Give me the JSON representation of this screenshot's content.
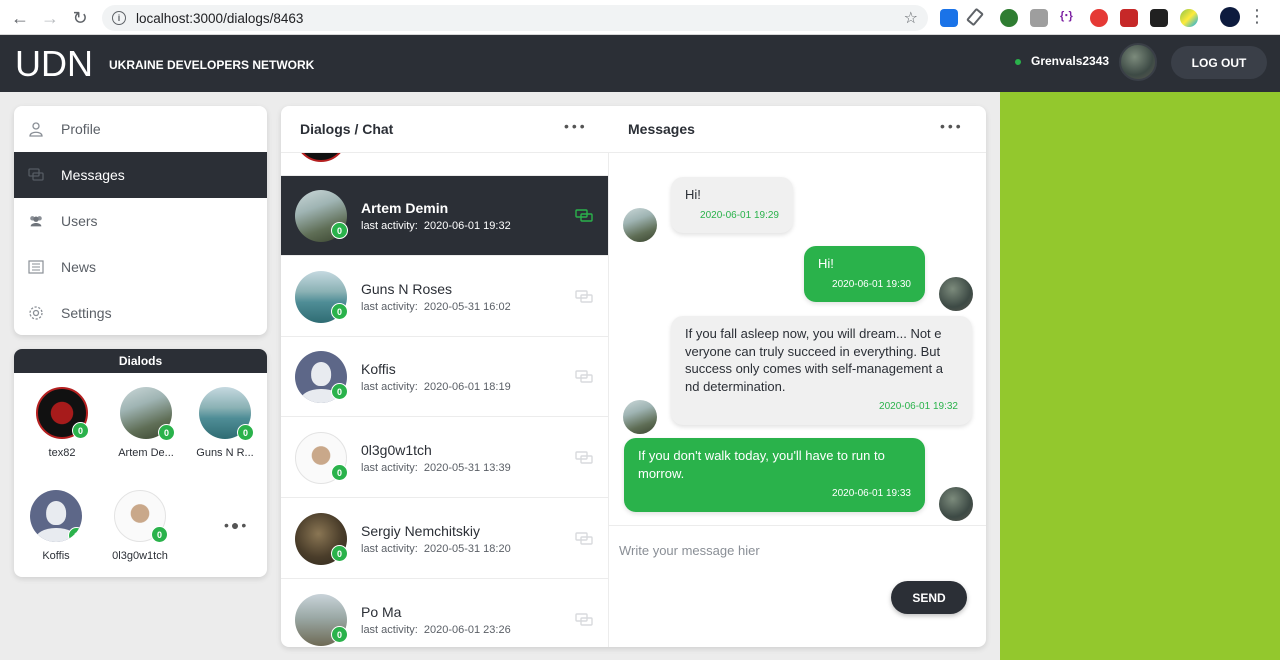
{
  "browser": {
    "url": "localhost:3000/dialogs/8463"
  },
  "header": {
    "logo": "UDN",
    "subtitle": "UKRAINE DEVELOPERS NETWORK",
    "username": "Grenvals2343",
    "logout_label": "LOG OUT"
  },
  "sidebar": {
    "items": [
      {
        "label": "Profile",
        "icon": "user-icon"
      },
      {
        "label": "Messages",
        "icon": "messages-icon",
        "active": true
      },
      {
        "label": "Users",
        "icon": "users-icon"
      },
      {
        "label": "News",
        "icon": "news-icon"
      },
      {
        "label": "Settings",
        "icon": "gear-icon"
      }
    ]
  },
  "dialogs_box": {
    "title": "Dialods",
    "users": [
      {
        "name": "tex82",
        "badge": "0"
      },
      {
        "name": "Artem De...",
        "badge": "0"
      },
      {
        "name": "Guns N R...",
        "badge": "0"
      },
      {
        "name": "Koffis",
        "badge": "0"
      },
      {
        "name": "0l3g0w1tch",
        "badge": "0"
      }
    ]
  },
  "chat": {
    "left_title": "Dialogs / Chat",
    "right_title": "Messages",
    "activity_label": "last activity:",
    "dialogs": [
      {
        "name": "Artem Demin",
        "time": "2020-06-01 19:32",
        "badge": "0",
        "active": true
      },
      {
        "name": "Guns N Roses",
        "time": "2020-05-31 16:02",
        "badge": "0"
      },
      {
        "name": "Koffis",
        "time": "2020-06-01 18:19",
        "badge": "0"
      },
      {
        "name": "0l3g0w1tch",
        "time": "2020-05-31 13:39",
        "badge": "0"
      },
      {
        "name": "Sergiy Nemchitskiy",
        "time": "2020-05-31 18:20",
        "badge": "0"
      },
      {
        "name": "Po Ma",
        "time": "2020-06-01 23:26",
        "badge": "0"
      }
    ],
    "messages": [
      {
        "direction": "in",
        "text": "Hi!",
        "time": "2020-06-01 19:29"
      },
      {
        "direction": "out",
        "text": "Hi!",
        "time": "2020-06-01 19:30"
      },
      {
        "direction": "in",
        "text": "If you fall asleep now, you will dream... Not e veryone can truly succeed in everything. But success only comes with self-management a nd determination.",
        "time": "2020-06-01 19:32"
      },
      {
        "direction": "out",
        "text": "If you don't walk today, you'll have to run to morrow.",
        "time": "2020-06-01 19:33"
      }
    ],
    "compose_placeholder": "Write your message hier",
    "send_label": "SEND"
  },
  "colors": {
    "dark": "#2b2f36",
    "accent_green": "#2ab24b",
    "side_green": "#93c82d"
  }
}
